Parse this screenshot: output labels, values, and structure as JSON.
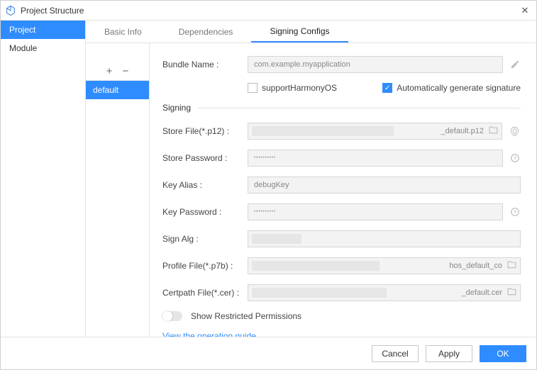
{
  "window": {
    "title": "Project Structure"
  },
  "leftnav": {
    "items": [
      {
        "label": "Project",
        "active": true
      },
      {
        "label": "Module",
        "active": false
      }
    ]
  },
  "midcol": {
    "entries": [
      {
        "label": "default",
        "active": true
      }
    ]
  },
  "tabs": [
    {
      "label": "Basic Info",
      "active": false
    },
    {
      "label": "Dependencies",
      "active": false
    },
    {
      "label": "Signing Configs",
      "active": true
    }
  ],
  "bundle": {
    "label": "Bundle Name :",
    "value": "com.example.myapplication",
    "support_label": "supportHarmonyOS",
    "autogen_label": "Automatically generate signature",
    "autogen_checked": true,
    "support_checked": false
  },
  "signing": {
    "title": "Signing",
    "store_file_label": "Store File(*.p12) :",
    "store_file_suffix": "_default.p12",
    "store_password_label": "Store Password :",
    "store_password_value": "••••••••••",
    "key_alias_label": "Key Alias :",
    "key_alias_value": "debugKey",
    "key_password_label": "Key Password :",
    "key_password_value": "••••••••••",
    "sign_alg_label": "Sign Alg :",
    "profile_file_label": "Profile File(*.p7b) :",
    "profile_file_suffix": "hos_default_co",
    "certpath_label": "Certpath File(*.cer) :",
    "certpath_suffix": "_default.cer",
    "show_restricted_label": "Show Restricted Permissions",
    "guide_link": "View the operation guide"
  },
  "footer": {
    "cancel": "Cancel",
    "apply": "Apply",
    "ok": "OK"
  }
}
